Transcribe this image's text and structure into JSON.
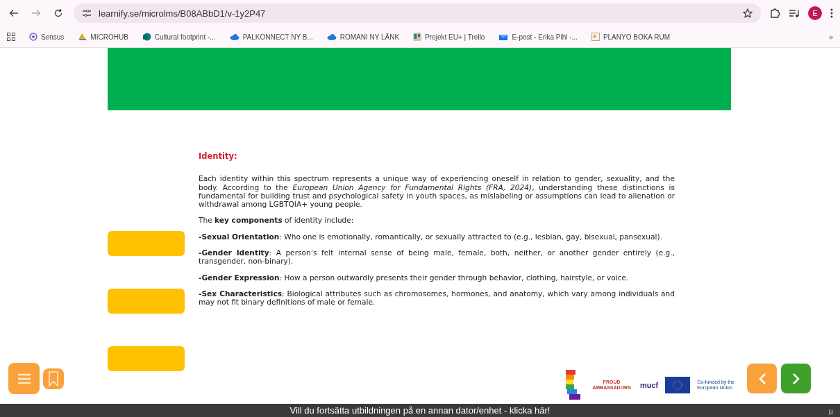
{
  "browser": {
    "url": "learnify.se/microlms/B08ABbD1/v-1y2P47",
    "profile_initial": "E",
    "bookmarks": [
      {
        "label": "Sensus"
      },
      {
        "label": "MICROHUB"
      },
      {
        "label": "Cultural footprint -..."
      },
      {
        "label": "PALKONNECT NY B..."
      },
      {
        "label": "ROMANI NY LÄNK"
      },
      {
        "label": "Projekt EU+ | Trello"
      },
      {
        "label": "E-post - Erika Pihl -..."
      },
      {
        "label": "PLANYO BOKA RUM"
      }
    ],
    "more": "»"
  },
  "lesson": {
    "heading": "Identity:",
    "paragraphs": [
      "Each identity within this spectrum represents a unique way of experiencing oneself in relation to gender, sexuality, and the body. According to the *European Union Agency for Fundamental Rights (FRA, 2024)*, understanding these distinctions is fundamental for building trust and psychological safety in youth spaces, as mislabeling or assumptions can lead to alienation or withdrawal among LGBTQIA+ young people.",
      "The **key components** of identity include:",
      "**-Sexual Orientation**: Who one is emotionally, romantically, or sexually attracted to (e.g., lesbian, gay, bisexual, pansexual).",
      "**-Gender Identity**: A person’s felt internal sense of being male, female, both, neither, or another gender entirely (e.g., transgender, non-binary).",
      "**-Gender Expression**: How a person outwardly presents their gender through behavior, clothing, hairstyle, or voice.",
      "**-Sex Characteristics**: Biological attributes such as chromosomes, hormones, and anatomy, which vary among individuals and may not fit binary definitions of male or female."
    ],
    "cards": [
      {
        "kind": "tile"
      },
      {
        "kind": "tile"
      },
      {
        "kind": "tile"
      }
    ]
  },
  "logos": {
    "proud": "PROUD AMBASSADORS",
    "mucf": "mucf",
    "eu": "Co-funded by the European Union"
  },
  "footer": {
    "text": "Vill du fortsätta utbildningen på en annan dator/enhet - klicka här!",
    "corner": "µ"
  }
}
